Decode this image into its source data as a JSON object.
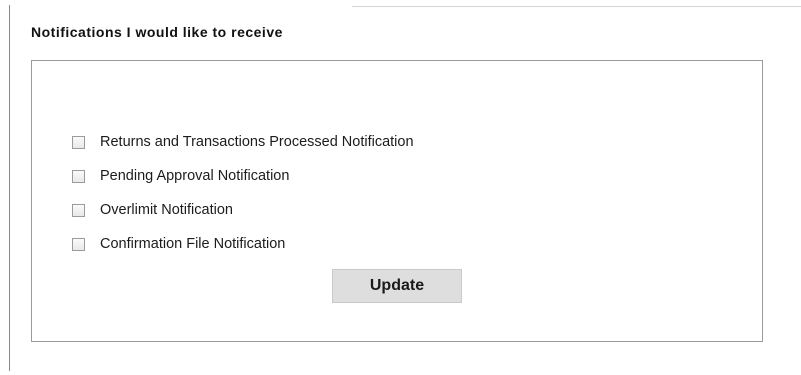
{
  "section": {
    "title": "Notifications I would like to receive"
  },
  "notifications": [
    {
      "label": "Returns and Transactions Processed Notification",
      "checked": false
    },
    {
      "label": "Pending Approval Notification",
      "checked": false
    },
    {
      "label": "Overlimit Notification",
      "checked": false
    },
    {
      "label": "Confirmation File Notification",
      "checked": false
    }
  ],
  "actions": {
    "update_label": "Update"
  },
  "colors": {
    "panel_border": "#9a9a9a",
    "button_bg": "#dedede"
  }
}
